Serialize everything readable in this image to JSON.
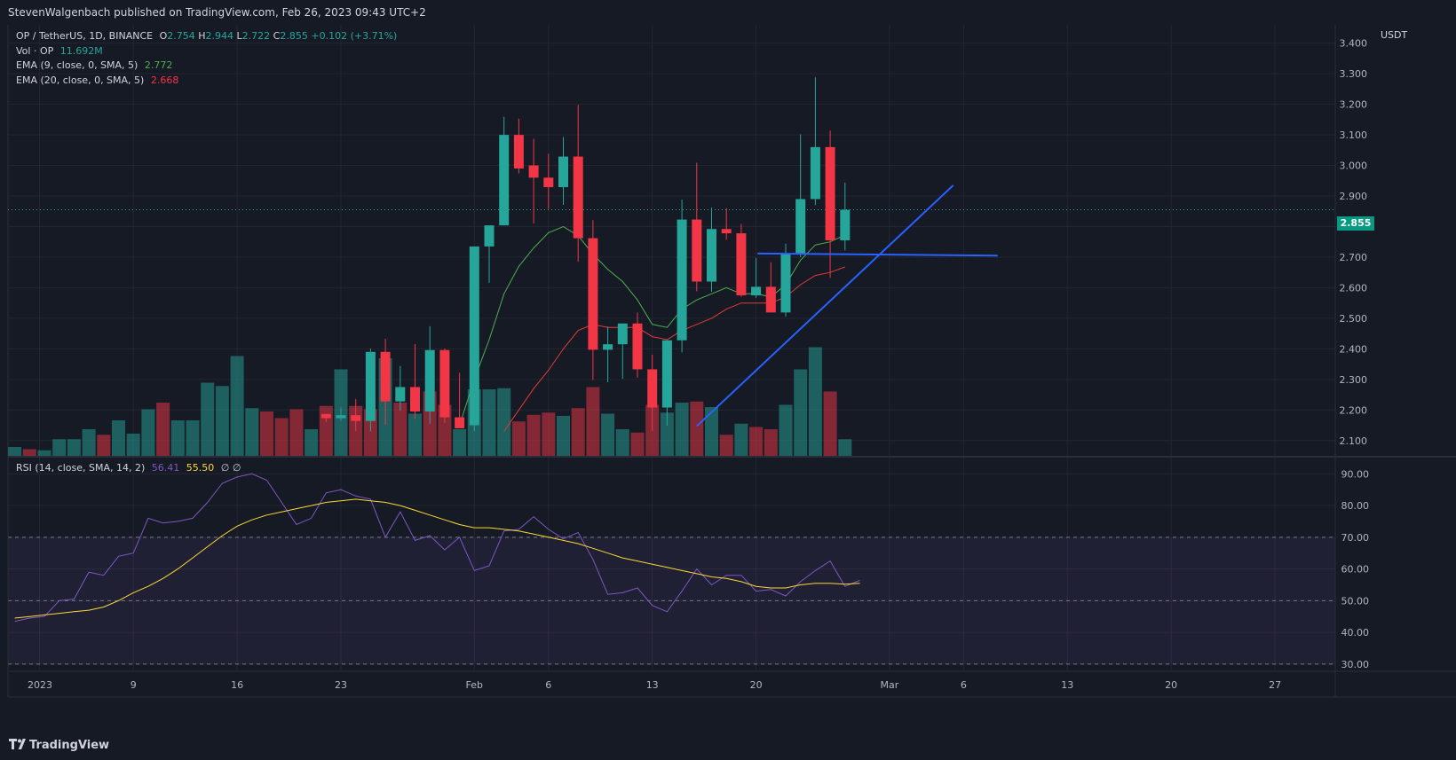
{
  "header": {
    "publisher_text": "StevenWalgenbach published on TradingView.com, Feb 26, 2023 09:43 UTC+2"
  },
  "legend": {
    "symbol": "OP / TetherUS, 1D, BINANCE",
    "o_label": "O",
    "o_value": "2.754",
    "h_label": "H",
    "h_value": "2.944",
    "l_label": "L",
    "l_value": "2.722",
    "c_label": "C",
    "c_value": "2.855",
    "change": "+0.102 (+3.71%)",
    "vol_label": "Vol · OP",
    "vol_value": "11.692M",
    "ema9_label": "EMA (9, close, 0, SMA, 5)",
    "ema9_value": "2.772",
    "ema20_label": "EMA (20, close, 0, SMA, 5)",
    "ema20_value": "2.668",
    "rsi_label": "RSI (14, close, SMA, 14, 2)",
    "rsi_value": "56.41",
    "rsi_ma_value": "55.50",
    "rsi_extra": "∅ ∅"
  },
  "currency": "USDT",
  "price_badge": "2.855",
  "brand": "TradingView",
  "colors": {
    "up": "#26a69a",
    "down": "#f23645",
    "ema9": "#4caf50",
    "ema20": "#e53935",
    "rsi": "#7e57c2",
    "rsi_ma": "#fdd835",
    "trend": "#2962ff",
    "badge": "#089981"
  },
  "chart_data": {
    "type": "candlestick",
    "price_axis": {
      "ylim": [
        2.05,
        3.46
      ],
      "ticks": [
        "2.100",
        "2.200",
        "2.300",
        "2.400",
        "2.500",
        "2.600",
        "2.700",
        "2.800",
        "2.900",
        "3.000",
        "3.100",
        "3.200",
        "3.300",
        "3.400"
      ]
    },
    "x_axis_labels": [
      {
        "label": "2023",
        "index": 0
      },
      {
        "label": "9",
        "index": 8
      },
      {
        "label": "16",
        "index": 15
      },
      {
        "label": "23",
        "index": 22
      },
      {
        "label": "Feb",
        "index": 31
      },
      {
        "label": "6",
        "index": 36
      },
      {
        "label": "13",
        "index": 43
      },
      {
        "label": "20",
        "index": 50
      },
      {
        "label": "Mar",
        "index": 59
      },
      {
        "label": "6",
        "index": 64
      },
      {
        "label": "13",
        "index": 71
      },
      {
        "label": "20",
        "index": 78
      },
      {
        "label": "27",
        "index": 85
      }
    ],
    "candles": [
      [
        21,
        2.187,
        2.187,
        2.161,
        2.173
      ],
      [
        22,
        2.173,
        2.208,
        2.165,
        2.183
      ],
      [
        23,
        2.183,
        2.236,
        2.131,
        2.164
      ],
      [
        24,
        2.164,
        2.401,
        2.13,
        2.39
      ],
      [
        25,
        2.39,
        2.433,
        2.151,
        2.228
      ],
      [
        26,
        2.228,
        2.344,
        2.198,
        2.275
      ],
      [
        27,
        2.275,
        2.416,
        2.171,
        2.195
      ],
      [
        28,
        2.195,
        2.474,
        2.155,
        2.396
      ],
      [
        29,
        2.396,
        2.401,
        2.158,
        2.176
      ],
      [
        30,
        2.176,
        2.322,
        2.152,
        2.14
      ],
      [
        31,
        2.15,
        2.689,
        2.13,
        2.735
      ],
      [
        32,
        2.735,
        2.795,
        2.616,
        2.804
      ],
      [
        33,
        2.804,
        3.159,
        2.86,
        3.1
      ],
      [
        34,
        3.1,
        3.153,
        2.974,
        2.99
      ],
      [
        35,
        3.0,
        3.087,
        2.81,
        2.96
      ],
      [
        36,
        2.96,
        3.038,
        2.858,
        2.929
      ],
      [
        37,
        2.929,
        3.093,
        2.871,
        3.029
      ],
      [
        38,
        3.029,
        3.198,
        2.685,
        2.762
      ],
      [
        39,
        2.762,
        2.821,
        2.298,
        2.397
      ],
      [
        40,
        2.397,
        2.473,
        2.291,
        2.415
      ],
      [
        41,
        2.415,
        2.456,
        2.302,
        2.483
      ],
      [
        42,
        2.483,
        2.519,
        2.306,
        2.333
      ],
      [
        43,
        2.333,
        2.381,
        2.132,
        2.208
      ],
      [
        44,
        2.208,
        2.428,
        2.149,
        2.428
      ],
      [
        45,
        2.428,
        2.888,
        2.388,
        2.823
      ],
      [
        46,
        2.823,
        3.009,
        2.588,
        2.62
      ],
      [
        47,
        2.62,
        2.862,
        2.587,
        2.792
      ],
      [
        48,
        2.792,
        2.86,
        2.757,
        2.778
      ],
      [
        49,
        2.778,
        2.809,
        2.57,
        2.575
      ],
      [
        50,
        2.575,
        2.697,
        2.567,
        2.603
      ],
      [
        51,
        2.603,
        2.683,
        2.523,
        2.519
      ],
      [
        52,
        2.519,
        2.744,
        2.506,
        2.713
      ],
      [
        53,
        2.713,
        3.102,
        2.7,
        2.89
      ],
      [
        54,
        2.89,
        3.288,
        2.87,
        3.06
      ],
      [
        55,
        3.06,
        3.114,
        2.632,
        2.755
      ],
      [
        56,
        2.755,
        2.944,
        2.722,
        2.855
      ]
    ],
    "volume": [
      [
        0,
        4.0,
        "up"
      ],
      [
        1,
        3.0,
        "down"
      ],
      [
        2,
        2.5,
        "up"
      ],
      [
        3,
        7.5,
        "up"
      ],
      [
        4,
        7.5,
        "up"
      ],
      [
        5,
        12.0,
        "up"
      ],
      [
        6,
        9.5,
        "down"
      ],
      [
        7,
        16.0,
        "up"
      ],
      [
        8,
        10.0,
        "up"
      ],
      [
        9,
        21.0,
        "up"
      ],
      [
        10,
        24.0,
        "down"
      ],
      [
        11,
        16.0,
        "up"
      ],
      [
        12,
        16.0,
        "up"
      ],
      [
        13,
        33.0,
        "up"
      ],
      [
        14,
        31.5,
        "up"
      ],
      [
        15,
        45.0,
        "up"
      ],
      [
        16,
        21.5,
        "up"
      ],
      [
        17,
        20.0,
        "down"
      ],
      [
        18,
        17.0,
        "down"
      ],
      [
        19,
        21.0,
        "down"
      ],
      [
        20,
        12.0,
        "up"
      ],
      [
        21,
        22.5,
        "down"
      ],
      [
        22,
        39.0,
        "up"
      ],
      [
        23,
        22.5,
        "down"
      ],
      [
        24,
        21.0,
        "down"
      ],
      [
        25,
        44.0,
        "up"
      ],
      [
        26,
        24.0,
        "down"
      ],
      [
        27,
        19.0,
        "up"
      ],
      [
        28,
        29.0,
        "down"
      ],
      [
        29,
        23.0,
        "down"
      ],
      [
        30,
        12.0,
        "up"
      ],
      [
        31,
        30.0,
        "up"
      ],
      [
        32,
        30.0,
        "up"
      ],
      [
        33,
        30.5,
        "up"
      ],
      [
        34,
        15.5,
        "down"
      ],
      [
        35,
        18.5,
        "down"
      ],
      [
        36,
        19.5,
        "down"
      ],
      [
        37,
        18.0,
        "up"
      ],
      [
        38,
        21.5,
        "down"
      ],
      [
        39,
        31.0,
        "down"
      ],
      [
        40,
        19.0,
        "up"
      ],
      [
        41,
        12.0,
        "up"
      ],
      [
        42,
        10.5,
        "down"
      ],
      [
        43,
        23.0,
        "down"
      ],
      [
        44,
        19.5,
        "up"
      ],
      [
        45,
        24.0,
        "up"
      ],
      [
        46,
        24.5,
        "down"
      ],
      [
        47,
        22.0,
        "up"
      ],
      [
        48,
        9.5,
        "down"
      ],
      [
        49,
        14.5,
        "up"
      ],
      [
        50,
        13.0,
        "down"
      ],
      [
        51,
        12.0,
        "down"
      ],
      [
        52,
        23.0,
        "up"
      ],
      [
        53,
        39.0,
        "up"
      ],
      [
        54,
        49.0,
        "up"
      ],
      [
        55,
        29.0,
        "down"
      ],
      [
        56,
        7.5,
        "up"
      ]
    ],
    "ema9": [
      [
        30,
        2.15
      ],
      [
        31,
        2.3
      ],
      [
        32,
        2.43
      ],
      [
        33,
        2.58
      ],
      [
        34,
        2.67
      ],
      [
        35,
        2.73
      ],
      [
        36,
        2.78
      ],
      [
        37,
        2.8
      ],
      [
        38,
        2.77
      ],
      [
        39,
        2.71
      ],
      [
        40,
        2.66
      ],
      [
        41,
        2.62
      ],
      [
        42,
        2.56
      ],
      [
        43,
        2.48
      ],
      [
        44,
        2.47
      ],
      [
        45,
        2.53
      ],
      [
        46,
        2.56
      ],
      [
        47,
        2.58
      ],
      [
        48,
        2.6
      ],
      [
        49,
        2.58
      ],
      [
        50,
        2.58
      ],
      [
        51,
        2.57
      ],
      [
        52,
        2.61
      ],
      [
        53,
        2.69
      ],
      [
        54,
        2.74
      ],
      [
        55,
        2.75
      ],
      [
        56,
        2.772
      ]
    ],
    "ema20": [
      [
        33,
        2.13
      ],
      [
        34,
        2.2
      ],
      [
        35,
        2.27
      ],
      [
        36,
        2.33
      ],
      [
        37,
        2.4
      ],
      [
        38,
        2.46
      ],
      [
        39,
        2.48
      ],
      [
        40,
        2.47
      ],
      [
        41,
        2.47
      ],
      [
        42,
        2.47
      ],
      [
        43,
        2.44
      ],
      [
        44,
        2.43
      ],
      [
        45,
        2.46
      ],
      [
        46,
        2.48
      ],
      [
        47,
        2.5
      ],
      [
        48,
        2.53
      ],
      [
        49,
        2.55
      ],
      [
        50,
        2.55
      ],
      [
        51,
        2.55
      ],
      [
        52,
        2.57
      ],
      [
        53,
        2.61
      ],
      [
        54,
        2.64
      ],
      [
        55,
        2.65
      ],
      [
        56,
        2.668
      ]
    ],
    "trendlines": [
      {
        "from": [
          46.0,
          2.147
        ],
        "to": [
          63.3,
          2.935
        ]
      },
      {
        "from": [
          50.1,
          2.712
        ],
        "to": [
          66.3,
          2.705
        ]
      }
    ],
    "rsi_axis": {
      "ylim": [
        28,
        94
      ],
      "ticks": [
        "30.00",
        "40.00",
        "50.00",
        "60.00",
        "70.00",
        "80.00",
        "90.00"
      ],
      "band": [
        30,
        70
      ]
    },
    "rsi": [
      [
        0,
        43.5
      ],
      [
        1,
        44.5
      ],
      [
        2,
        45.0
      ],
      [
        3,
        50.0
      ],
      [
        4,
        50.5
      ],
      [
        5,
        59.0
      ],
      [
        6,
        58.0
      ],
      [
        7,
        64.0
      ],
      [
        8,
        65.0
      ],
      [
        9,
        76.0
      ],
      [
        10,
        74.5
      ],
      [
        11,
        75.0
      ],
      [
        12,
        76.0
      ],
      [
        13,
        81.0
      ],
      [
        14,
        87.0
      ],
      [
        15,
        89.0
      ],
      [
        16,
        90.0
      ],
      [
        17,
        88.0
      ],
      [
        18,
        81.0
      ],
      [
        19,
        74.0
      ],
      [
        20,
        76.0
      ],
      [
        21,
        84.0
      ],
      [
        22,
        85.0
      ],
      [
        23,
        83.0
      ],
      [
        24,
        82.0
      ],
      [
        25,
        70.0
      ],
      [
        26,
        78.0
      ],
      [
        27,
        69.0
      ],
      [
        28,
        70.5
      ],
      [
        29,
        66.0
      ],
      [
        30,
        70.0
      ],
      [
        31,
        59.5
      ],
      [
        32,
        61.0
      ],
      [
        33,
        72.0
      ],
      [
        34,
        72.5
      ],
      [
        35,
        76.5
      ],
      [
        36,
        72.5
      ],
      [
        37,
        69.5
      ],
      [
        38,
        71.5
      ],
      [
        39,
        63.0
      ],
      [
        40,
        52.0
      ],
      [
        41,
        52.5
      ],
      [
        42,
        54.0
      ],
      [
        43,
        48.5
      ],
      [
        44,
        46.5
      ],
      [
        45,
        53.0
      ],
      [
        46,
        60.0
      ],
      [
        47,
        55.0
      ],
      [
        48,
        58.0
      ],
      [
        49,
        58.0
      ],
      [
        50,
        53.0
      ],
      [
        51,
        53.5
      ],
      [
        52,
        51.5
      ],
      [
        53,
        56.0
      ],
      [
        54,
        59.5
      ],
      [
        55,
        62.5
      ],
      [
        56,
        54.5
      ],
      [
        57,
        56.41
      ]
    ],
    "rsi_ma": [
      [
        0,
        44.5
      ],
      [
        1,
        45.0
      ],
      [
        2,
        45.5
      ],
      [
        3,
        46.0
      ],
      [
        4,
        46.5
      ],
      [
        5,
        47.0
      ],
      [
        6,
        48.0
      ],
      [
        7,
        50.0
      ],
      [
        8,
        52.5
      ],
      [
        9,
        54.5
      ],
      [
        10,
        57.0
      ],
      [
        11,
        60.0
      ],
      [
        12,
        63.5
      ],
      [
        13,
        67.0
      ],
      [
        14,
        70.5
      ],
      [
        15,
        73.5
      ],
      [
        16,
        75.5
      ],
      [
        17,
        77.0
      ],
      [
        18,
        78.0
      ],
      [
        19,
        79.0
      ],
      [
        20,
        80.0
      ],
      [
        21,
        81.0
      ],
      [
        22,
        81.5
      ],
      [
        23,
        82.0
      ],
      [
        24,
        81.5
      ],
      [
        25,
        81.0
      ],
      [
        26,
        80.0
      ],
      [
        27,
        78.5
      ],
      [
        28,
        77.0
      ],
      [
        29,
        75.5
      ],
      [
        30,
        74.0
      ],
      [
        31,
        73.0
      ],
      [
        32,
        73.0
      ],
      [
        33,
        72.5
      ],
      [
        34,
        72.0
      ],
      [
        35,
        71.0
      ],
      [
        36,
        70.0
      ],
      [
        37,
        69.0
      ],
      [
        38,
        68.0
      ],
      [
        39,
        66.5
      ],
      [
        40,
        65.0
      ],
      [
        41,
        63.5
      ],
      [
        42,
        62.5
      ],
      [
        43,
        61.5
      ],
      [
        44,
        60.5
      ],
      [
        45,
        59.5
      ],
      [
        46,
        58.5
      ],
      [
        47,
        57.5
      ],
      [
        48,
        57.0
      ],
      [
        49,
        56.0
      ],
      [
        50,
        54.5
      ],
      [
        51,
        54.0
      ],
      [
        52,
        54.0
      ],
      [
        53,
        55.0
      ],
      [
        54,
        55.5
      ],
      [
        55,
        55.5
      ],
      [
        56,
        55.2
      ],
      [
        57,
        55.5
      ]
    ]
  }
}
